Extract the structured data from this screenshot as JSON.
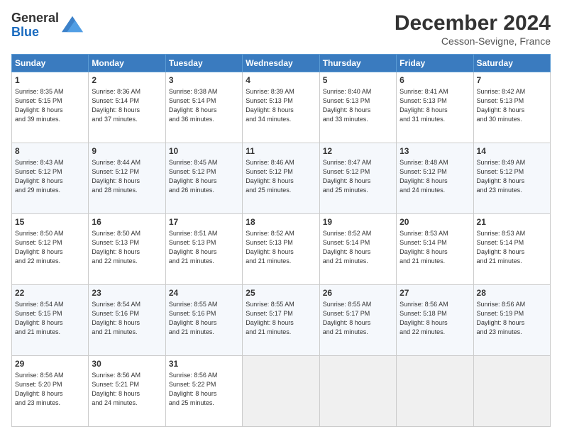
{
  "header": {
    "logo": {
      "line1": "General",
      "line2": "Blue"
    },
    "title": "December 2024",
    "location": "Cesson-Sevigne, France"
  },
  "calendar": {
    "days_of_week": [
      "Sunday",
      "Monday",
      "Tuesday",
      "Wednesday",
      "Thursday",
      "Friday",
      "Saturday"
    ],
    "weeks": [
      [
        {
          "day": "",
          "info": ""
        },
        {
          "day": "2",
          "info": "Sunrise: 8:36 AM\nSunset: 5:14 PM\nDaylight: 8 hours\nand 37 minutes."
        },
        {
          "day": "3",
          "info": "Sunrise: 8:38 AM\nSunset: 5:14 PM\nDaylight: 8 hours\nand 36 minutes."
        },
        {
          "day": "4",
          "info": "Sunrise: 8:39 AM\nSunset: 5:13 PM\nDaylight: 8 hours\nand 34 minutes."
        },
        {
          "day": "5",
          "info": "Sunrise: 8:40 AM\nSunset: 5:13 PM\nDaylight: 8 hours\nand 33 minutes."
        },
        {
          "day": "6",
          "info": "Sunrise: 8:41 AM\nSunset: 5:13 PM\nDaylight: 8 hours\nand 31 minutes."
        },
        {
          "day": "7",
          "info": "Sunrise: 8:42 AM\nSunset: 5:13 PM\nDaylight: 8 hours\nand 30 minutes."
        }
      ],
      [
        {
          "day": "8",
          "info": "Sunrise: 8:43 AM\nSunset: 5:12 PM\nDaylight: 8 hours\nand 29 minutes."
        },
        {
          "day": "9",
          "info": "Sunrise: 8:44 AM\nSunset: 5:12 PM\nDaylight: 8 hours\nand 28 minutes."
        },
        {
          "day": "10",
          "info": "Sunrise: 8:45 AM\nSunset: 5:12 PM\nDaylight: 8 hours\nand 26 minutes."
        },
        {
          "day": "11",
          "info": "Sunrise: 8:46 AM\nSunset: 5:12 PM\nDaylight: 8 hours\nand 25 minutes."
        },
        {
          "day": "12",
          "info": "Sunrise: 8:47 AM\nSunset: 5:12 PM\nDaylight: 8 hours\nand 25 minutes."
        },
        {
          "day": "13",
          "info": "Sunrise: 8:48 AM\nSunset: 5:12 PM\nDaylight: 8 hours\nand 24 minutes."
        },
        {
          "day": "14",
          "info": "Sunrise: 8:49 AM\nSunset: 5:12 PM\nDaylight: 8 hours\nand 23 minutes."
        }
      ],
      [
        {
          "day": "15",
          "info": "Sunrise: 8:50 AM\nSunset: 5:12 PM\nDaylight: 8 hours\nand 22 minutes."
        },
        {
          "day": "16",
          "info": "Sunrise: 8:50 AM\nSunset: 5:13 PM\nDaylight: 8 hours\nand 22 minutes."
        },
        {
          "day": "17",
          "info": "Sunrise: 8:51 AM\nSunset: 5:13 PM\nDaylight: 8 hours\nand 21 minutes."
        },
        {
          "day": "18",
          "info": "Sunrise: 8:52 AM\nSunset: 5:13 PM\nDaylight: 8 hours\nand 21 minutes."
        },
        {
          "day": "19",
          "info": "Sunrise: 8:52 AM\nSunset: 5:14 PM\nDaylight: 8 hours\nand 21 minutes."
        },
        {
          "day": "20",
          "info": "Sunrise: 8:53 AM\nSunset: 5:14 PM\nDaylight: 8 hours\nand 21 minutes."
        },
        {
          "day": "21",
          "info": "Sunrise: 8:53 AM\nSunset: 5:14 PM\nDaylight: 8 hours\nand 21 minutes."
        }
      ],
      [
        {
          "day": "22",
          "info": "Sunrise: 8:54 AM\nSunset: 5:15 PM\nDaylight: 8 hours\nand 21 minutes."
        },
        {
          "day": "23",
          "info": "Sunrise: 8:54 AM\nSunset: 5:16 PM\nDaylight: 8 hours\nand 21 minutes."
        },
        {
          "day": "24",
          "info": "Sunrise: 8:55 AM\nSunset: 5:16 PM\nDaylight: 8 hours\nand 21 minutes."
        },
        {
          "day": "25",
          "info": "Sunrise: 8:55 AM\nSunset: 5:17 PM\nDaylight: 8 hours\nand 21 minutes."
        },
        {
          "day": "26",
          "info": "Sunrise: 8:55 AM\nSunset: 5:17 PM\nDaylight: 8 hours\nand 21 minutes."
        },
        {
          "day": "27",
          "info": "Sunrise: 8:56 AM\nSunset: 5:18 PM\nDaylight: 8 hours\nand 22 minutes."
        },
        {
          "day": "28",
          "info": "Sunrise: 8:56 AM\nSunset: 5:19 PM\nDaylight: 8 hours\nand 23 minutes."
        }
      ],
      [
        {
          "day": "29",
          "info": "Sunrise: 8:56 AM\nSunset: 5:20 PM\nDaylight: 8 hours\nand 23 minutes."
        },
        {
          "day": "30",
          "info": "Sunrise: 8:56 AM\nSunset: 5:21 PM\nDaylight: 8 hours\nand 24 minutes."
        },
        {
          "day": "31",
          "info": "Sunrise: 8:56 AM\nSunset: 5:22 PM\nDaylight: 8 hours\nand 25 minutes."
        },
        {
          "day": "",
          "info": ""
        },
        {
          "day": "",
          "info": ""
        },
        {
          "day": "",
          "info": ""
        },
        {
          "day": "",
          "info": ""
        }
      ]
    ],
    "first_week_first": {
      "day": "1",
      "info": "Sunrise: 8:35 AM\nSunset: 5:15 PM\nDaylight: 8 hours\nand 39 minutes."
    }
  }
}
